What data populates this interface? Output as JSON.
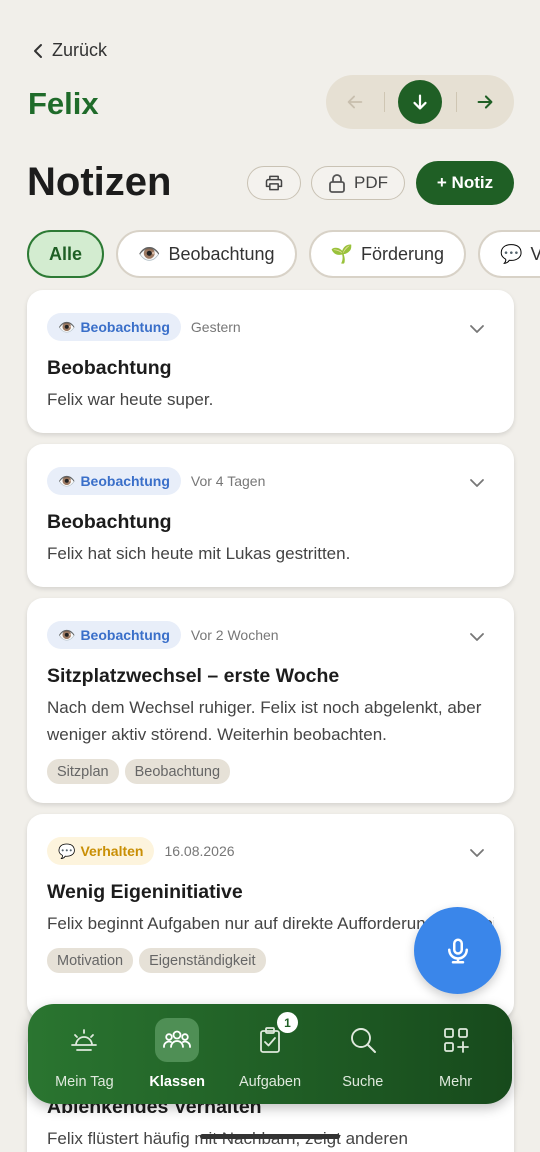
{
  "header": {
    "back_label": "Zurück",
    "student_name": "Felix",
    "title": "Notizen",
    "pdf_label": "PDF",
    "add_note_label": "+ Notiz"
  },
  "filters": [
    {
      "label": "Alle",
      "icon": "",
      "active": true
    },
    {
      "label": "Beobachtung",
      "icon": "👁️",
      "active": false
    },
    {
      "label": "Förderung",
      "icon": "🌱",
      "active": false
    },
    {
      "label": "V",
      "icon": "💬",
      "active": false
    }
  ],
  "notes": [
    {
      "badge_icon": "👁️",
      "badge": "Beobachtung",
      "date": "Gestern",
      "title": "Beobachtung",
      "text": "Felix war heute super.",
      "tags": []
    },
    {
      "badge_icon": "👁️",
      "badge": "Beobachtung",
      "date": "Vor 4 Tagen",
      "title": "Beobachtung",
      "text": "Felix hat sich heute mit Lukas gestritten.",
      "tags": []
    },
    {
      "badge_icon": "👁️",
      "badge": "Beobachtung",
      "date": "Vor 2 Wochen",
      "title": "Sitzplatzwechsel – erste Woche",
      "text": "Nach dem Wechsel ruhiger. Felix ist noch abgelenkt, aber weniger aktiv störend. Weiterhin beobachten.",
      "tags": [
        "Sitzplan",
        "Beobachtung"
      ]
    },
    {
      "badge_icon": "💬",
      "badge": "Verhalten",
      "date": "16.08.2026",
      "title": "Wenig Eigeninitiative",
      "text": "Felix beginnt Aufgaben nur auf direkte Aufforderung hin. Bei freier Arbeit wartet er, bis jemand hilft.",
      "tags": [
        "Motivation",
        "Eigenständigkeit"
      ]
    },
    {
      "badge_icon": "",
      "badge": "",
      "date": "",
      "title": "Ablenkendes Verhalten",
      "text": "Felix flüstert häufig mit Nachbarn, zeigt anderen",
      "tags": []
    }
  ],
  "bottom_nav": [
    {
      "label": "Mein Tag",
      "icon": "sunrise-icon",
      "active": false
    },
    {
      "label": "Klassen",
      "icon": "group-icon",
      "active": true
    },
    {
      "label": "Aufgaben",
      "icon": "clipboard-check-icon",
      "active": false,
      "badge": "1"
    },
    {
      "label": "Suche",
      "icon": "search-icon",
      "active": false
    },
    {
      "label": "Mehr",
      "icon": "grid-plus-icon",
      "active": false
    }
  ],
  "colors": {
    "primary": "#1f5f25",
    "background": "#f1efea",
    "observation": "#3a6fc9",
    "behavior": "#c98f05",
    "fab": "#3a86ea"
  }
}
